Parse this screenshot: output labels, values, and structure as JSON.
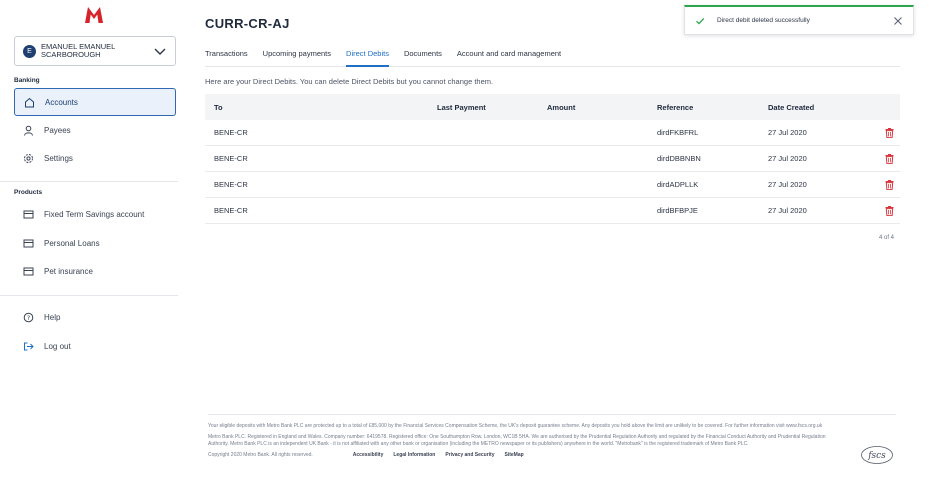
{
  "sidebar": {
    "logo": "M",
    "user": {
      "initial": "E",
      "name_line1": "EMANUEL EMANUEL",
      "name_line2": "SCARBOROUGH"
    },
    "sections": [
      {
        "label": "Banking",
        "items": [
          {
            "label": "Accounts",
            "icon": "home-icon",
            "active": true
          },
          {
            "label": "Payees",
            "icon": "person-icon"
          },
          {
            "label": "Settings",
            "icon": "gear-icon"
          }
        ]
      },
      {
        "label": "Products",
        "items": [
          {
            "label": "Fixed Term Savings account",
            "icon": "card-icon"
          },
          {
            "label": "Personal Loans",
            "icon": "card-icon"
          },
          {
            "label": "Pet insurance",
            "icon": "card-icon"
          }
        ]
      }
    ],
    "bottom_items": [
      {
        "label": "Help",
        "icon": "help-icon"
      },
      {
        "label": "Log out",
        "icon": "logout-icon"
      }
    ]
  },
  "main": {
    "account_title": "CURR-CR-AJ",
    "tabs": [
      {
        "label": "Transactions"
      },
      {
        "label": "Upcoming payments"
      },
      {
        "label": "Direct Debits",
        "active": true
      },
      {
        "label": "Documents"
      },
      {
        "label": "Account and card management"
      }
    ],
    "intro": "Here are your Direct Debits. You can delete Direct Debits but you cannot change them.",
    "table": {
      "headers": [
        "To",
        "Last Payment",
        "Amount",
        "Reference",
        "Date Created"
      ],
      "rows": [
        {
          "to": "BENE-CR",
          "last_payment": "",
          "amount": "",
          "reference": "dirdFKBFRL",
          "date_created": "27 Jul 2020"
        },
        {
          "to": "BENE-CR",
          "last_payment": "",
          "amount": "",
          "reference": "dirdDBBNBN",
          "date_created": "27 Jul 2020"
        },
        {
          "to": "BENE-CR",
          "last_payment": "",
          "amount": "",
          "reference": "dirdADPLLK",
          "date_created": "27 Jul 2020"
        },
        {
          "to": "BENE-CR",
          "last_payment": "",
          "amount": "",
          "reference": "dirdBFBPJE",
          "date_created": "27 Jul 2020"
        }
      ],
      "pager": "4 of 4"
    }
  },
  "toast": {
    "message": "Direct debit deleted successfully"
  },
  "footer": {
    "protection": "Your eligible deposits with Metro Bank PLC are protected up to a total of £85,000 by the Financial Services Compensation Scheme, the UK's deposit guarantee scheme. Any deposits you hold above the limit are unlikely to be covered. For further information visit www.fscs.org.uk",
    "registration": "Metro Bank PLC. Registered in England and Wales. Company number: 6419578. Registered office: One Southampton Row, London, WC1B 5HA. We are authorised by the Prudential Regulation Authority and regulated by the Financial Conduct Authority and Prudential Regulation Authority. Metro Bank PLC is an independent UK Bank - it is not affiliated with any other bank or organisation (including the METRO newspaper or its publishers) anywhere in the world. \"Metrobank\" is the registered trademark of Metro Bank PLC.",
    "copyright": "Copyright 2020 Metro Bank. All rights reserved.",
    "links": [
      "Accessibility",
      "Legal Information",
      "Privacy and Security",
      "SiteMap"
    ],
    "fscs_logo": "fscs"
  },
  "colors": {
    "brand_red": "#d6232b",
    "accent_blue": "#1f6fc4",
    "success_green": "#2ea44f",
    "delete_red": "#d9363e"
  }
}
